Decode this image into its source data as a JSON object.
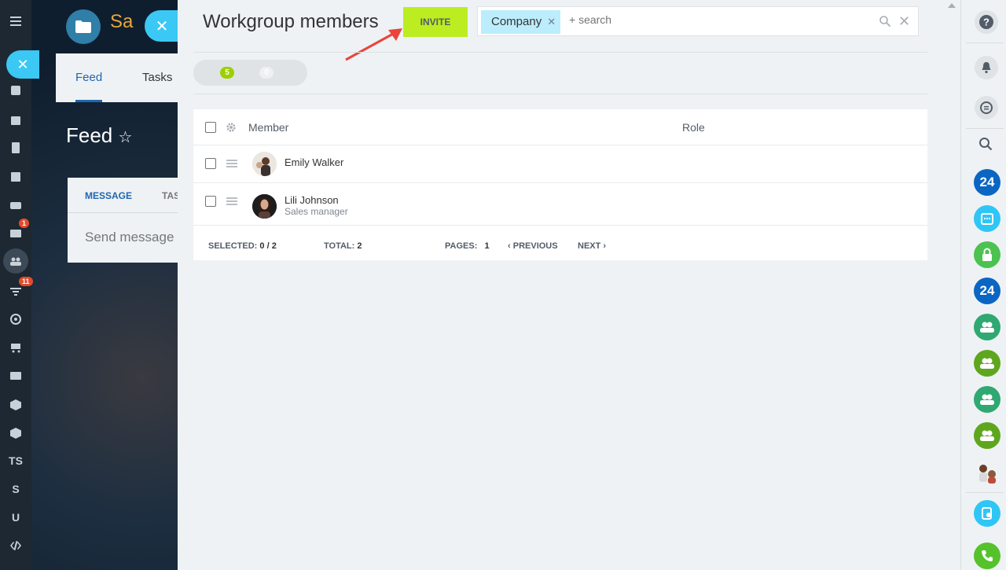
{
  "background": {
    "app_name": "Sa",
    "tabs": [
      "Feed",
      "Tasks"
    ],
    "page_title": "Feed",
    "message_tab": "MESSAGE",
    "message_tab2": "TAS",
    "send_message_placeholder": "Send message",
    "left_rail": {
      "mail_badge": "1",
      "filter_badge": "11",
      "letters": [
        "TS",
        "S",
        "U"
      ]
    }
  },
  "panel": {
    "title": "Workgroup members",
    "invite_label": "INVITE",
    "filter_chip": "Company",
    "search_placeholder": "+ search",
    "counters": {
      "active": "5",
      "other": "0"
    },
    "grid": {
      "columns": [
        "Member",
        "Role"
      ],
      "rows": [
        {
          "name": "Emily Walker",
          "position": ""
        },
        {
          "name": "Lili Johnson",
          "position": "Sales manager"
        }
      ],
      "footer": {
        "selected_label": "SELECTED:",
        "selected_value": "0 / 2",
        "total_label": "TOTAL:",
        "total_value": "2",
        "pages_label": "PAGES:",
        "pages_value": "1",
        "previous": "PREVIOUS",
        "next": "NEXT"
      }
    }
  },
  "right_bar": {
    "round_labels": [
      "24",
      "24"
    ]
  },
  "colors": {
    "invite": "#bbed21",
    "accent": "#3bc8f5",
    "chip": "#bcedfc",
    "counter_active": "#9dcf00"
  }
}
